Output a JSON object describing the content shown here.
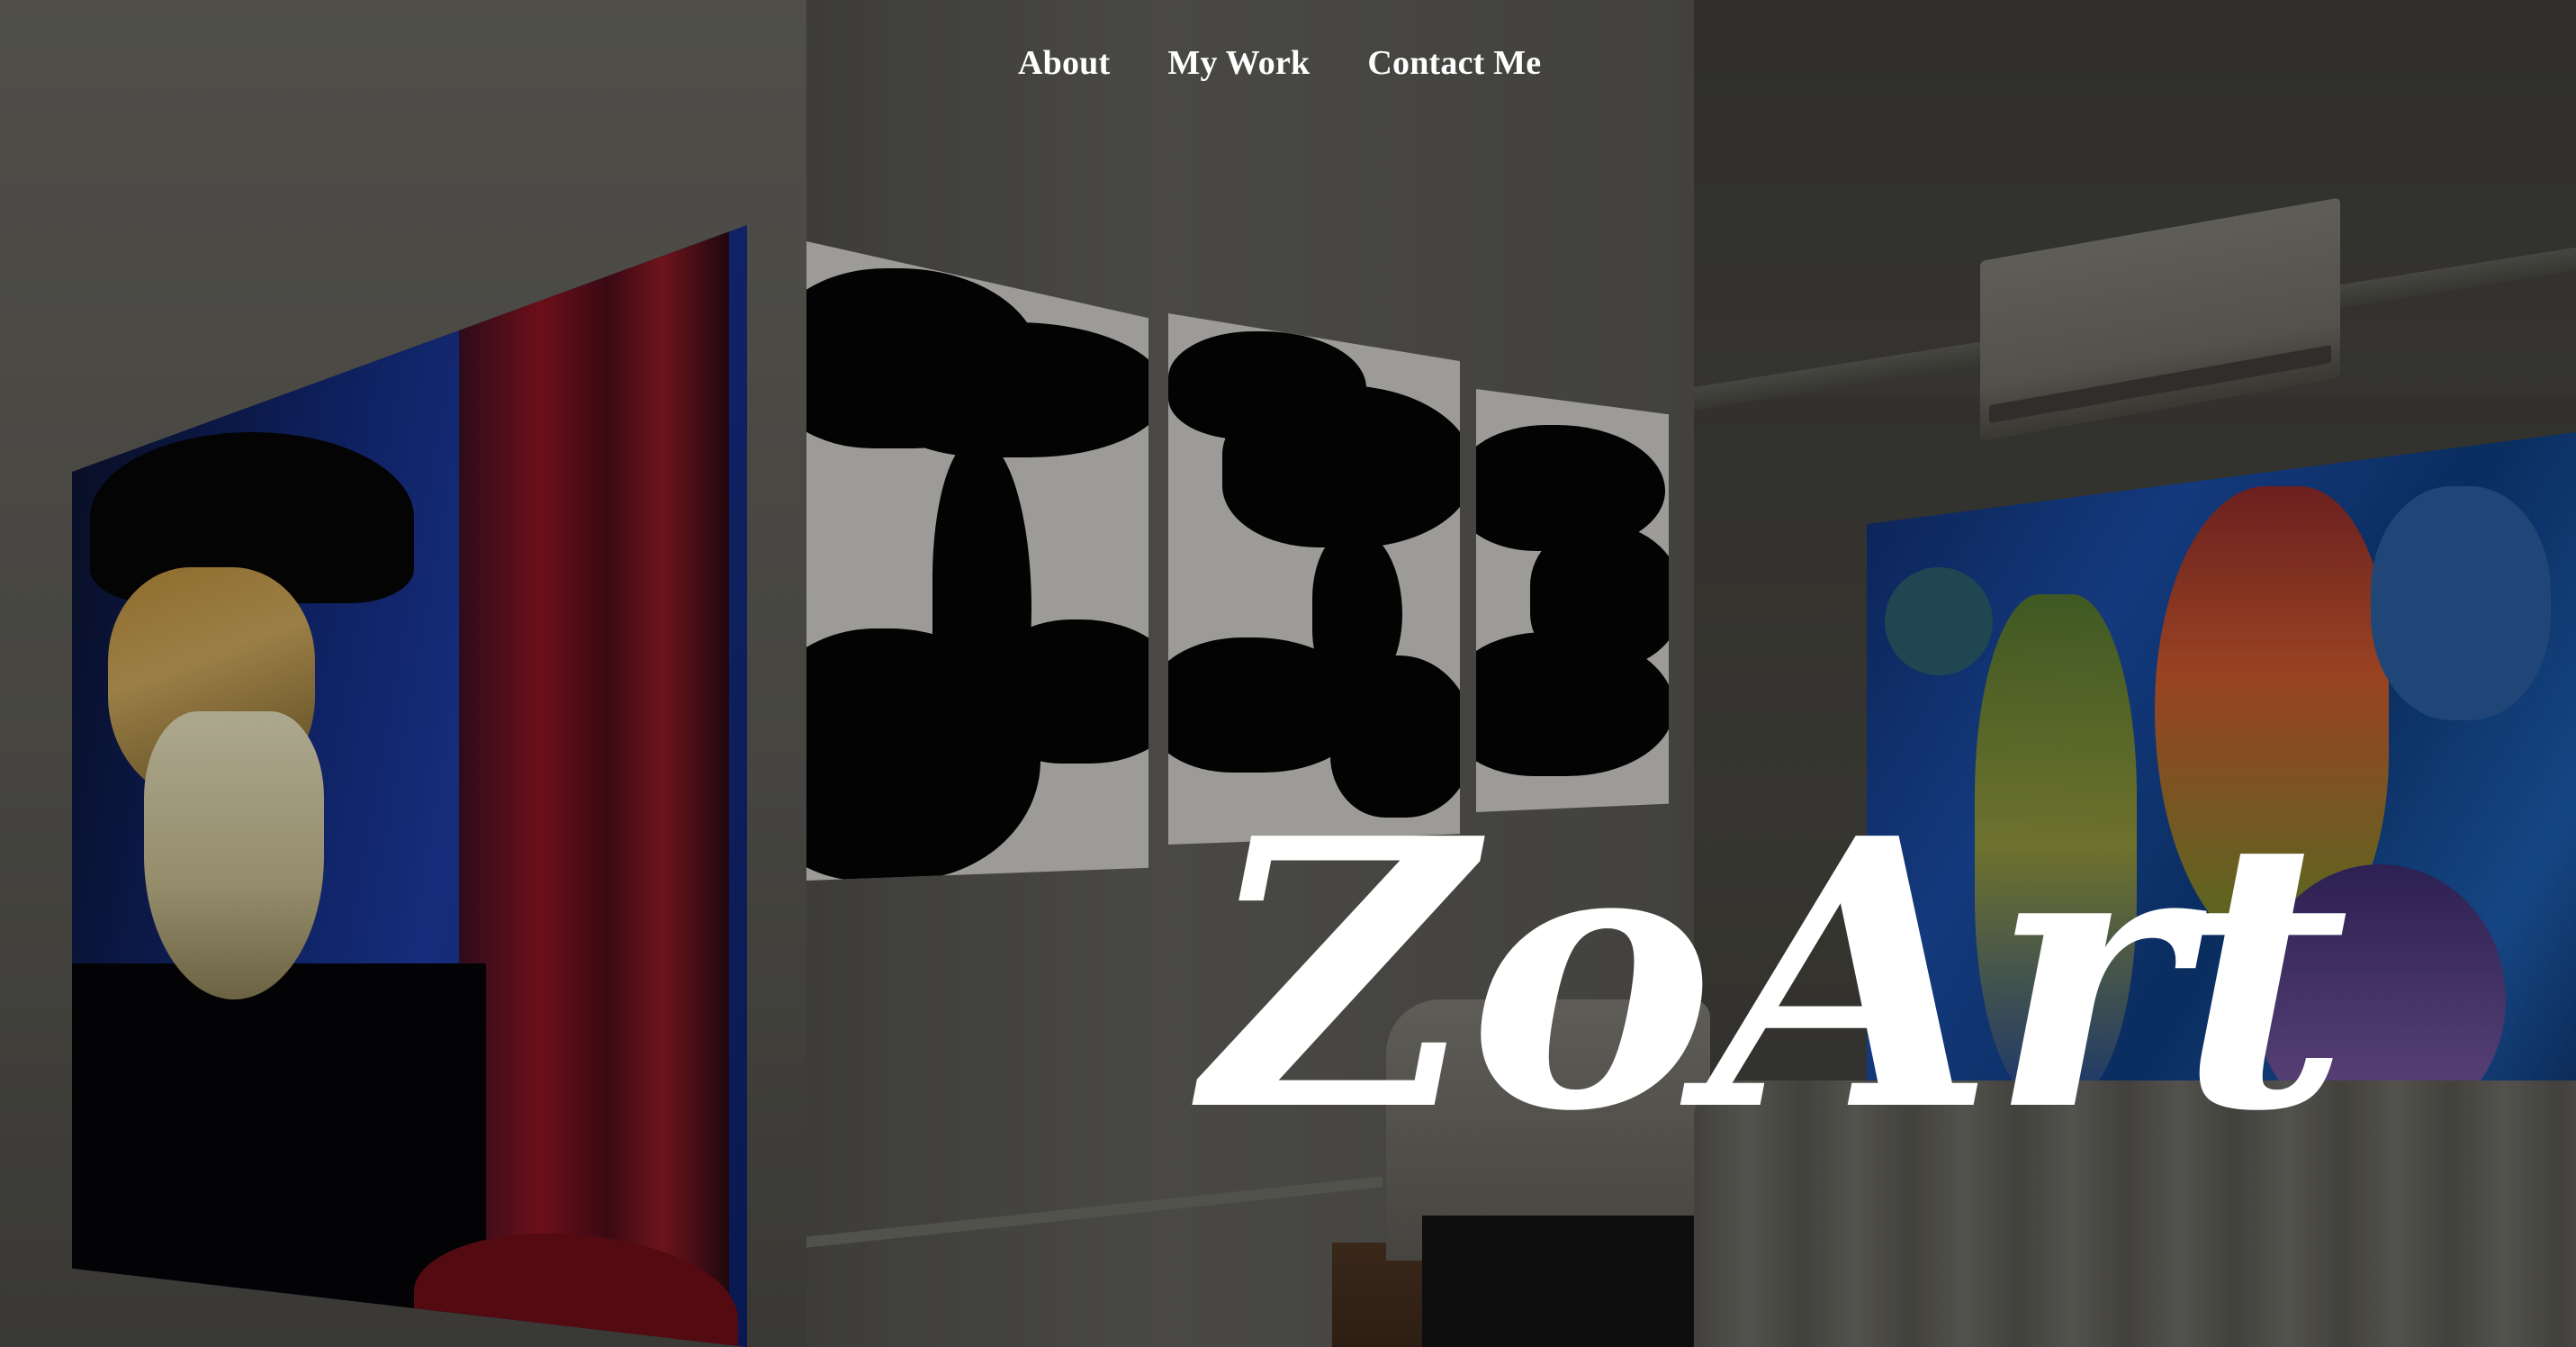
{
  "nav": {
    "items": [
      {
        "label": "About"
      },
      {
        "label": "My Work"
      },
      {
        "label": "Contact Me"
      }
    ]
  },
  "hero": {
    "title": "ZoArt"
  },
  "colors": {
    "text": "#ffffff",
    "overlay": "#000000"
  },
  "background": {
    "description_icon": "photo-background"
  }
}
